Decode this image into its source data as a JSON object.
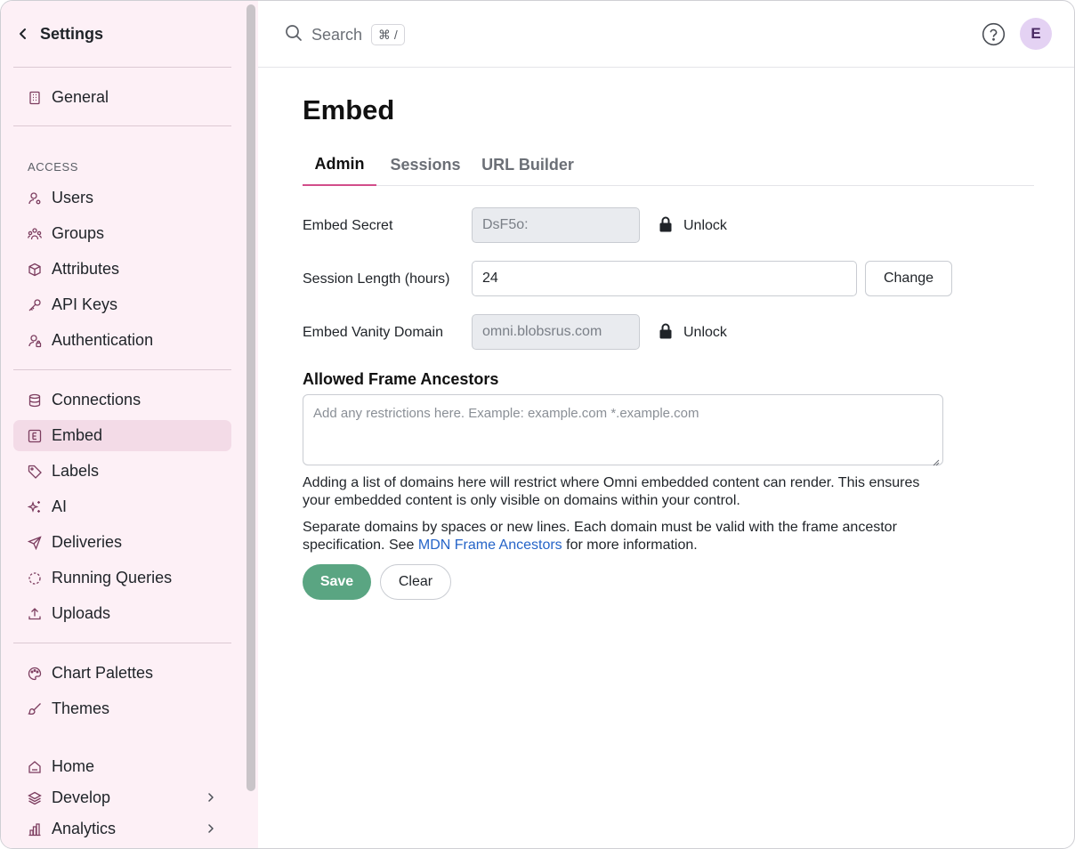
{
  "sidebar": {
    "title": "Settings",
    "general": "General",
    "access_section": "ACCESS",
    "access_items": [
      "Users",
      "Groups",
      "Attributes",
      "API Keys",
      "Authentication"
    ],
    "data_items": [
      "Connections",
      "Embed",
      "Labels",
      "AI",
      "Deliveries",
      "Running Queries",
      "Uploads"
    ],
    "style_items": [
      "Chart Palettes",
      "Themes"
    ],
    "nav_items": [
      "Home",
      "Develop",
      "Analytics"
    ],
    "active_item": "Embed"
  },
  "topbar": {
    "search_placeholder": "Search",
    "search_shortcut": "⌘ /",
    "avatar_initial": "E"
  },
  "page": {
    "title": "Embed",
    "tabs": [
      "Admin",
      "Sessions",
      "URL Builder"
    ],
    "active_tab": "Admin"
  },
  "form": {
    "embed_secret_label": "Embed Secret",
    "embed_secret_value": "DsF5o:",
    "unlock_label": "Unlock",
    "session_length_label": "Session Length (hours)",
    "session_length_value": "24",
    "change_label": "Change",
    "vanity_domain_label": "Embed Vanity Domain",
    "vanity_domain_value": "omni.blobsrus.com",
    "ancestors_title": "Allowed Frame Ancestors",
    "ancestors_placeholder": "Add any restrictions here. Example: example.com *.example.com",
    "help_text_1": "Adding a list of domains here will restrict where Omni embedded content can render. This ensures your embedded content is only visible on domains within your control.",
    "help_text_2_prefix": "Separate domains by spaces or new lines. Each domain must be valid with the frame ancestor specification. See ",
    "help_text_2_link": "MDN Frame Ancestors",
    "help_text_2_suffix": " for more information.",
    "save_label": "Save",
    "clear_label": "Clear"
  },
  "colors": {
    "sidebar_bg": "#fdf0f6",
    "active_item_bg": "#f3dbe7",
    "tab_underline": "#d24d8a",
    "save_button": "#5aa582",
    "link": "#2564c8",
    "avatar_bg": "#e4d2f3"
  }
}
